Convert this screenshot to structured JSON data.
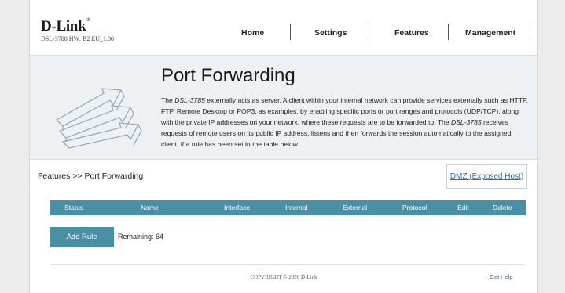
{
  "brand": {
    "logo": "D-Link",
    "reg": "®",
    "model": "DSL-3788  HW: B2  EU_1.00"
  },
  "nav": [
    "Home",
    "Settings",
    "Features",
    "Management"
  ],
  "banner": {
    "title": "Port Forwarding",
    "line1a": "The ",
    "model_a": "DSL-3785",
    "line1b": " externally acts as server. A client within your internal network can provide services externally such as HTTP, FTP, Remote Desktop or POP3, as examples, by enabling specific ports or port ranges and protocols (UDP/TCP), along with the private IP addresses on your network, where these requests are to be forwarded to. The ",
    "model_b": "DSL-3785",
    "line1c": " receives requests of remote users on its public IP address, listens and then forwards the session automatically to the assigned client, if a rule has been set in the table below."
  },
  "breadcrumb": "Features >> Port Forwarding",
  "dmz_link": "DMZ (Exposed Host)",
  "table": {
    "columns": [
      "Status",
      "Name",
      "Interface",
      "Internal",
      "External",
      "Protocol",
      "Edit",
      "Delete"
    ]
  },
  "add_rule": "Add Rule",
  "remaining": "Remaining: 64",
  "footer": {
    "copyright": "COPYRIGHT © 2020 D-Link",
    "help": "Get Help"
  },
  "colors": {
    "accent": "#4a90a4",
    "link": "#2b6cc4",
    "banner_bg": "#eef1f3"
  }
}
